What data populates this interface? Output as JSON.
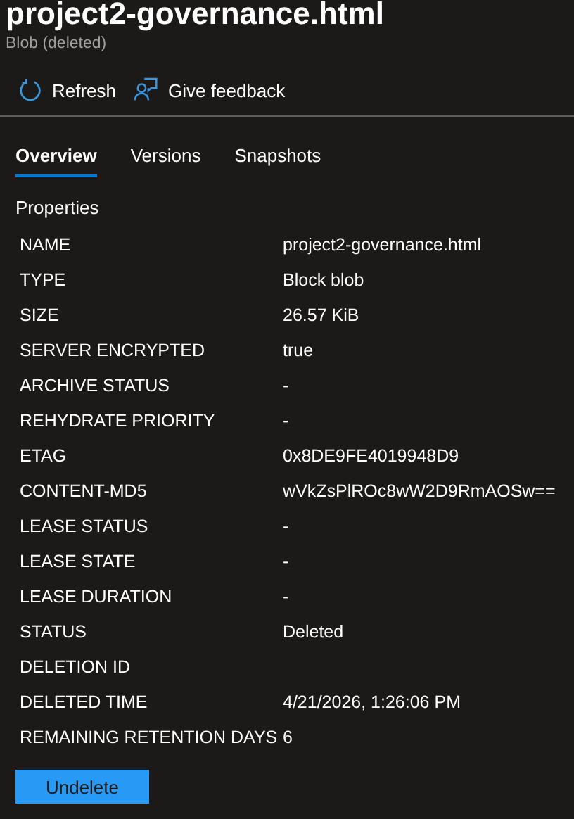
{
  "header": {
    "title": "project2-governance.html",
    "subtitle": "Blob (deleted)"
  },
  "toolbar": [
    {
      "kind": "refresh",
      "label": "Refresh"
    },
    {
      "kind": "feedback",
      "label": "Give feedback"
    }
  ],
  "tabs": [
    {
      "label": "Overview",
      "selected": true
    },
    {
      "label": "Versions",
      "selected": false
    },
    {
      "label": "Snapshots",
      "selected": false
    }
  ],
  "properties": {
    "heading": "Properties",
    "rows": [
      {
        "label": "NAME",
        "value": "project2-governance.html"
      },
      {
        "label": "TYPE",
        "value": "Block blob"
      },
      {
        "label": "SIZE",
        "value": "26.57 KiB"
      },
      {
        "label": "SERVER ENCRYPTED",
        "value": "true"
      },
      {
        "label": "ARCHIVE STATUS",
        "value": "-"
      },
      {
        "label": "REHYDRATE PRIORITY",
        "value": "-"
      },
      {
        "label": "ETAG",
        "value": "0x8DE9FE4019948D9"
      },
      {
        "label": "CONTENT-MD5",
        "value": "wVkZsPlROc8wW2D9RmAOSw=="
      },
      {
        "label": "LEASE STATUS",
        "value": "-"
      },
      {
        "label": "LEASE STATE",
        "value": "-"
      },
      {
        "label": "LEASE DURATION",
        "value": "-"
      },
      {
        "label": "STATUS",
        "value": "Deleted"
      },
      {
        "label": "DELETION ID"
      },
      {
        "label": "DELETED TIME",
        "value": "4/21/2026, 1:26:06 PM"
      },
      {
        "label": "REMAINING RETENTION DAYS",
        "value": "6"
      }
    ]
  },
  "action": {
    "label": "Undelete"
  }
}
